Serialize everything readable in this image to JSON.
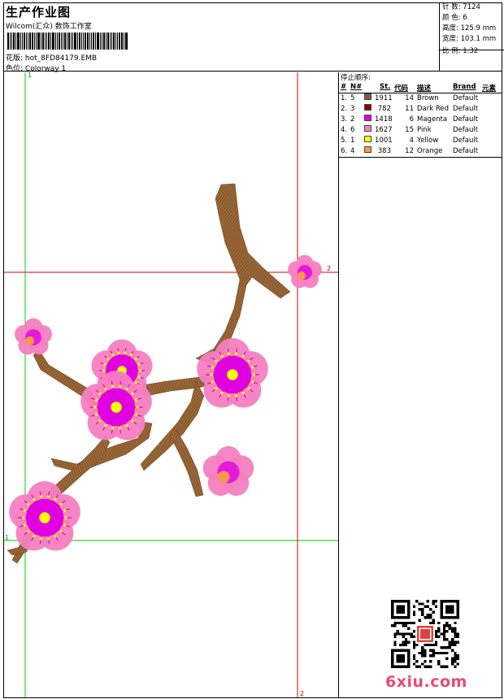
{
  "header": {
    "title": "生产作业图",
    "subtitle": "Wilcom(汇众) 数饰工作室",
    "pattern_label": "花版:",
    "pattern_value": "hot_8FD84179.EMB",
    "colorway_label": "色位:",
    "colorway_value": "Colorway 1"
  },
  "stats": [
    {
      "label": "针 数:",
      "value": "7124"
    },
    {
      "label": "颜 色:",
      "value": "6"
    },
    {
      "label": "高度:",
      "value": "125.9 mm"
    },
    {
      "label": "宽度:",
      "value": "103.1 mm"
    },
    {
      "label": "比 例:",
      "value": "1.32"
    }
  ],
  "stop_sequence": {
    "title": "停止顺序:",
    "columns": [
      "#",
      "N#",
      "St.",
      "代码",
      "描述",
      "Brand",
      "元素"
    ],
    "rows": [
      {
        "index": "1.",
        "n": "5",
        "color": "#8B5A2B",
        "stitches": "1911",
        "code": "14",
        "description": "Brown",
        "brand": "Default"
      },
      {
        "index": "2.",
        "n": "3",
        "color": "#8B0000",
        "stitches": "782",
        "code": "11",
        "description": "Dark Red",
        "brand": "Default"
      },
      {
        "index": "3.",
        "n": "2",
        "color": "#E000E0",
        "stitches": "1418",
        "code": "6",
        "description": "Magenta",
        "brand": "Default"
      },
      {
        "index": "4.",
        "n": "6",
        "color": "#F47FC0",
        "stitches": "1627",
        "code": "15",
        "description": "Pink",
        "brand": "Default"
      },
      {
        "index": "5.",
        "n": "1",
        "color": "#FFFF00",
        "stitches": "1001",
        "code": "4",
        "description": "Yellow",
        "brand": "Default"
      },
      {
        "index": "6.",
        "n": "4",
        "color": "#F59A4A",
        "stitches": "383",
        "code": "12",
        "description": "Orange",
        "brand": "Default"
      }
    ]
  },
  "guides": {
    "green_vertical_label": "1",
    "green_horizontal_label": "1",
    "red_vertical_label": "2",
    "red_horizontal_label": "2"
  },
  "watermark": "6xiu.com",
  "colors": {
    "branch": "#8B5E34",
    "petal": "#F47FC0",
    "magenta": "#E000E0",
    "yellow": "#FFFF00",
    "orange": "#F59A4A",
    "guide_green": "#00CC00",
    "guide_red": "#E00000"
  }
}
